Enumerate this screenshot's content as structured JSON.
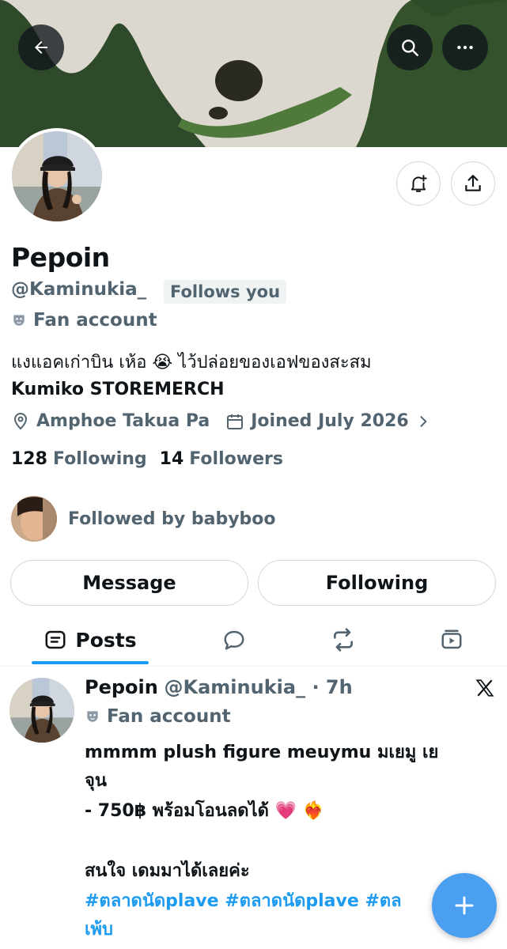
{
  "profile": {
    "display_name": "Pepoin",
    "handle": "@Kaminukia_",
    "follows_you": "Follows you",
    "category": "Fan account",
    "bio_line1": "แงแอคเก่าบิน เห้อ 😭 ไว้ปล่อยของเอฟของสะสม",
    "bio_line2": "Kumiko STOREMERCH",
    "location": "Amphoe Takua Pa",
    "joined": "Joined July 2026",
    "following_count": "128",
    "following_label": "Following",
    "followers_count": "14",
    "followers_label": "Followers",
    "followed_by": "Followed by babyboo"
  },
  "actions": {
    "message": "Message",
    "following": "Following"
  },
  "tabs": {
    "posts": "Posts"
  },
  "post": {
    "author_name": "Pepoin",
    "author_meta": "@Kaminukia_ · 7h",
    "category": "Fan account",
    "line1": "mmmm plush figure meuymu  มเยมู เย",
    "line2": "จุน",
    "line3": "- 750฿ พร้อมโอนลดได้ 💗 ❤️‍🔥",
    "line4": "สนใจ เดมมาได้เลยค่ะ",
    "hashtags": "#ตลาดนัดplave #ตลาดนัดplave #ตล",
    "line6": "เพ้บ"
  },
  "colors": {
    "accent": "#1d9bf0",
    "secondary_text": "#536471",
    "border": "#cfd9de"
  },
  "icons": [
    "back-arrow-icon",
    "search-icon",
    "more-icon",
    "notification-bell-icon",
    "share-icon",
    "mask-icon",
    "location-pin-icon",
    "calendar-icon",
    "chevron-right-icon",
    "posts-tab-icon",
    "replies-tab-icon",
    "reposts-tab-icon",
    "media-tab-icon",
    "x-logo-icon",
    "plus-icon"
  ]
}
